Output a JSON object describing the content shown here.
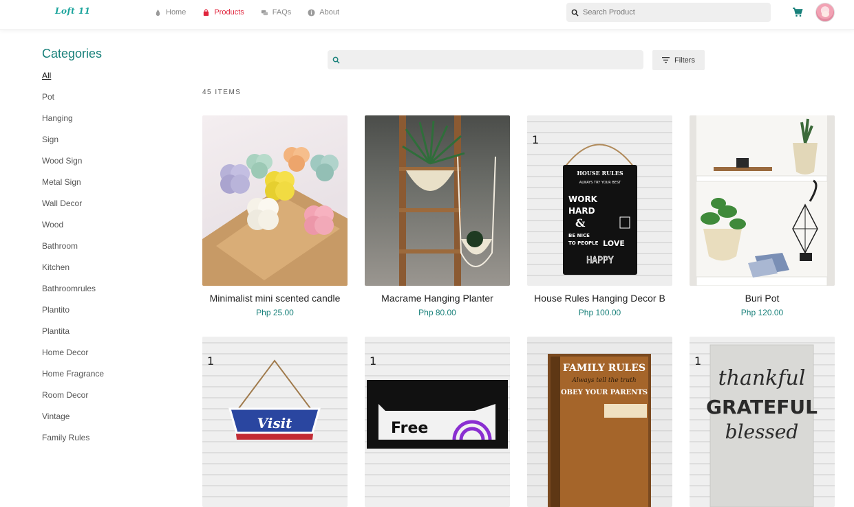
{
  "header": {
    "logo": "Loft 11",
    "nav": [
      {
        "label": "Home",
        "icon": "drop-icon",
        "active": false
      },
      {
        "label": "Products",
        "icon": "bag-icon",
        "active": true
      },
      {
        "label": "FAQs",
        "icon": "chat-icon",
        "active": false
      },
      {
        "label": "About",
        "icon": "info-icon",
        "active": false
      }
    ],
    "search_placeholder": "Search Product"
  },
  "sidebar": {
    "title": "Categories",
    "items": [
      "All",
      "Pot",
      "Hanging",
      "Sign",
      "Wood Sign",
      "Metal Sign",
      "Wall Decor",
      "Wood",
      "Bathroom",
      "Kitchen",
      "Bathroomrules",
      "Plantito",
      "Plantita",
      "Home Decor",
      "Home Fragrance",
      "Room Decor",
      "Vintage",
      "Family Rules"
    ],
    "active": "All"
  },
  "toolbar": {
    "filters_label": "Filters",
    "item_count": "45 ITEMS"
  },
  "products": [
    {
      "name": "Minimalist mini scented candle",
      "price": "Php 25.00"
    },
    {
      "name": "Macrame Hanging Planter",
      "price": "Php 80.00"
    },
    {
      "name": "House Rules Hanging Decor B",
      "price": "Php 100.00"
    },
    {
      "name": "Buri Pot",
      "price": "Php 120.00"
    },
    {
      "name": "",
      "price": ""
    },
    {
      "name": "",
      "price": ""
    },
    {
      "name": "",
      "price": ""
    },
    {
      "name": "",
      "price": ""
    }
  ],
  "product_images": {
    "sign_title": "HOUSE RULES",
    "sign_line1": "ALWAYS TRY YOUR BEST",
    "sign_work": "WORK",
    "sign_hard": "HARD",
    "sign_amp": "&",
    "sign_benice": "BE NICE",
    "sign_topeople": "TO PEOPLE",
    "sign_love": "LOVE",
    "sign_happy": "HAPPY",
    "visit": "Visit",
    "free": "Free",
    "wifi": "Wi-Fi",
    "family_rules": "FAMILY RULES",
    "always_tell": "Always tell the truth",
    "obey": "OBEY YOUR PARENTS",
    "thankful": "thankful",
    "grateful": "GRATEFUL",
    "blessed": "blessed",
    "badge": "1"
  },
  "colors": {
    "accent": "#18807a",
    "active_nav": "#e0243c"
  }
}
